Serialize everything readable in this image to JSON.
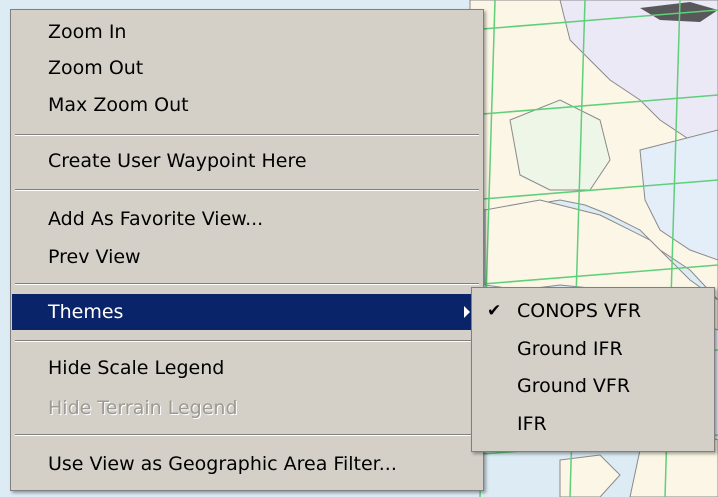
{
  "context_menu": {
    "items": [
      {
        "label": "Zoom In"
      },
      {
        "label": "Zoom Out"
      },
      {
        "label": "Max Zoom Out"
      },
      {
        "label": "Create User Waypoint Here"
      },
      {
        "label": "Add As Favorite View..."
      },
      {
        "label": "Prev View"
      },
      {
        "label": "Themes"
      },
      {
        "label": "Hide Scale Legend"
      },
      {
        "label": "Hide Terrain Legend"
      },
      {
        "label": "Use View as Geographic Area Filter..."
      }
    ],
    "highlighted_item": "Themes",
    "disabled_item": "Hide Terrain Legend"
  },
  "themes_submenu": {
    "items": [
      {
        "label": "CONOPS VFR",
        "checked": true
      },
      {
        "label": "Ground IFR",
        "checked": false
      },
      {
        "label": "Ground VFR",
        "checked": false
      },
      {
        "label": "IFR",
        "checked": false
      }
    ],
    "check_glyph": "✔"
  },
  "colors": {
    "menu_bg": "#d4d0c8",
    "highlight_bg": "#0a246a",
    "disabled_text": "#9c9a94",
    "map_land": "#fbf6e6",
    "map_water": "#dcebf4",
    "grid_line": "#5fcf7a"
  }
}
